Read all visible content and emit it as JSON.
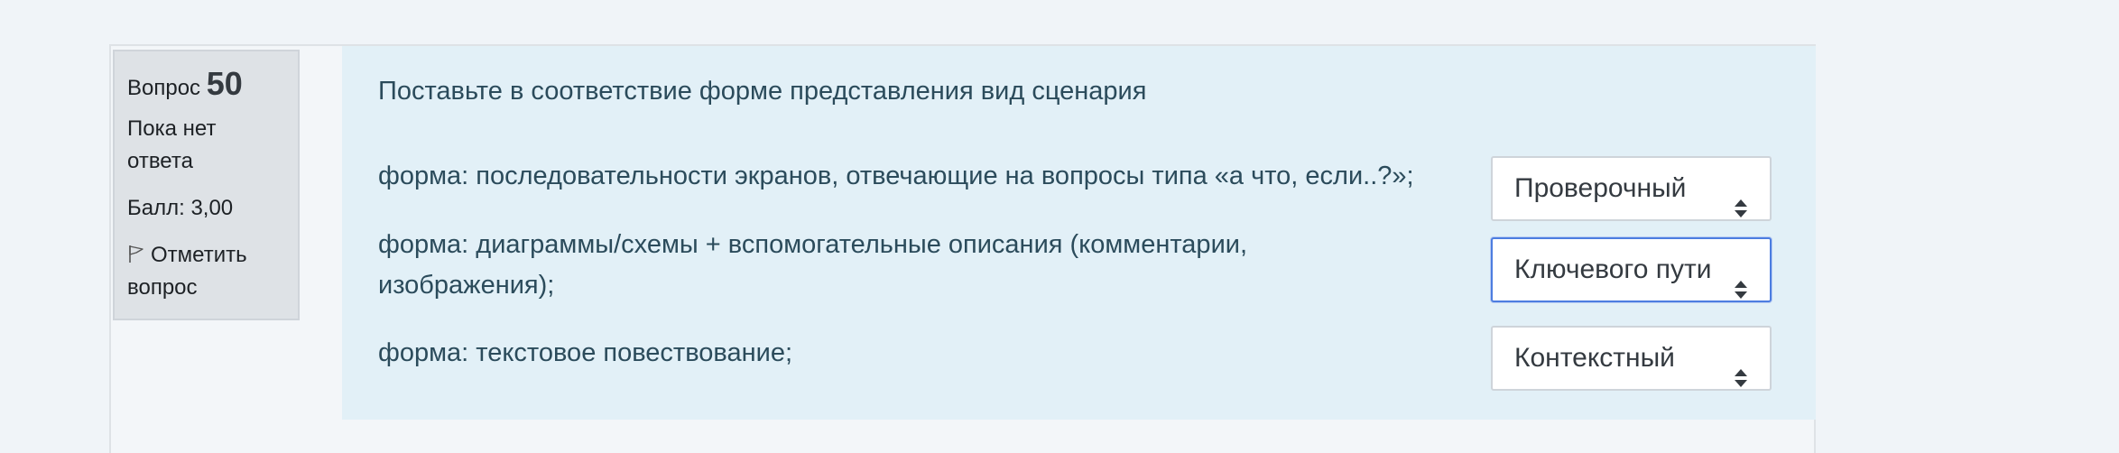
{
  "question": {
    "label": "Вопрос",
    "number": "50",
    "state": "Пока нет ответа",
    "grade": "Балл: 3,00",
    "flag_label": "Отметить вопрос",
    "text": "Поставьте в соответствие форме представления вид сценария"
  },
  "rows": [
    {
      "text": "форма: последовательности экранов, отвечающие на вопросы типа «а что, если..?»;",
      "selected": "Проверочный"
    },
    {
      "text": "форма: диаграммы/схемы + вспомогательные описания (комментарии, изображения);",
      "selected": "Ключевого пути"
    },
    {
      "text": "форма: текстовое повествование;",
      "selected": "Контекстный"
    }
  ],
  "colors": {
    "page_bg": "#f0f4f8",
    "content_bg": "#e2f0f7",
    "info_bg": "#dee2e6",
    "text": "#2b4b5b",
    "focus_border": "#4d7de0"
  },
  "icons": {
    "flag": "flag-icon",
    "select_arrows": "sort-arrows-icon"
  }
}
